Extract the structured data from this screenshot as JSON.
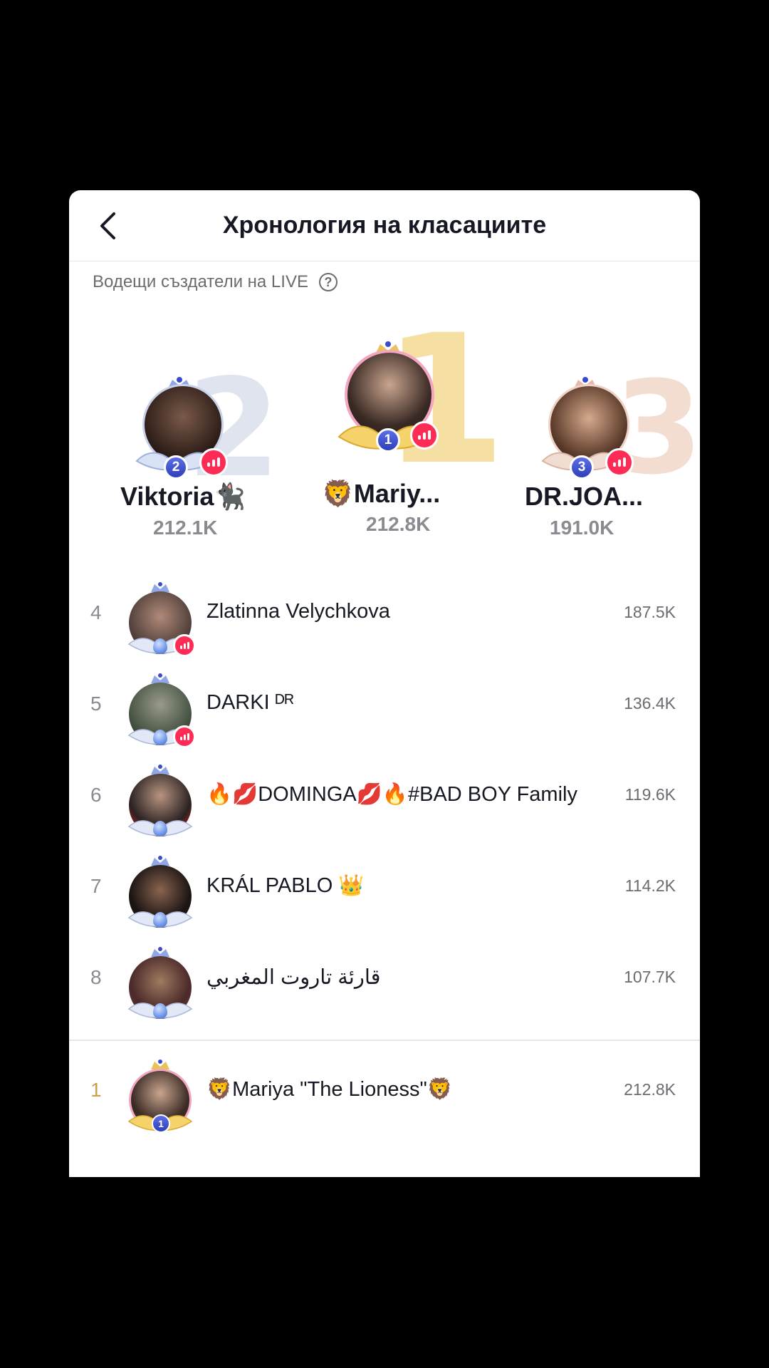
{
  "header": {
    "title": "Хронология на класациите"
  },
  "subtitle": "Водещи създатели на LIVE",
  "help_icon": "?",
  "podium": [
    {
      "rank_label": "2",
      "name": "Viktoria🐈‍⬛",
      "score": "212.1K",
      "live": true
    },
    {
      "rank_label": "1",
      "name": "🦁Mariy...",
      "score": "212.8K",
      "live": true
    },
    {
      "rank_label": "3",
      "name": "DR.JOA...",
      "score": "191.0K",
      "live": true
    }
  ],
  "list": [
    {
      "rank": "4",
      "name": "Zlatinna Velychkova",
      "score": "187.5K",
      "live": true
    },
    {
      "rank": "5",
      "name": "DARKI ᴰᴿ",
      "score": "136.4K",
      "live": true
    },
    {
      "rank": "6",
      "name": "🔥💋DOMINGA💋🔥#BAD BOY Family",
      "score": "119.6K",
      "live": false
    },
    {
      "rank": "7",
      "name": "KRÁL PABLO 👑",
      "score": "114.2K",
      "live": false
    },
    {
      "rank": "8",
      "name": "قارئة تاروت المغربي",
      "score": "107.7K",
      "live": false
    }
  ],
  "self_row": {
    "rank": "1",
    "name": "🦁Mariya \"The Lioness\"🦁",
    "score": "212.8K",
    "badge_rank": "1"
  },
  "colors": {
    "live_badge": "#fe2c55",
    "gold": "#c9a24a",
    "rank_badge": "#3a4bd0"
  }
}
